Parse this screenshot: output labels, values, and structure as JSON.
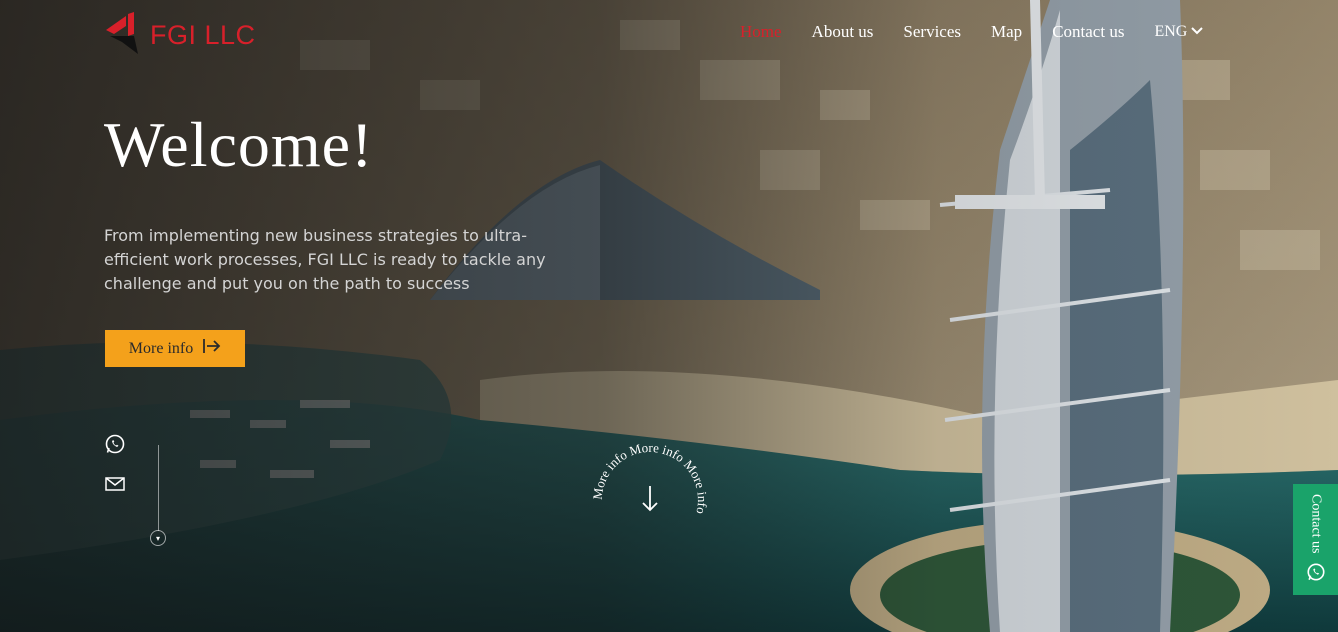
{
  "brand": {
    "name": "FGI LLC",
    "color": "#d8202a"
  },
  "nav": {
    "items": [
      {
        "label": "Home",
        "active": true
      },
      {
        "label": "About us",
        "active": false
      },
      {
        "label": "Services",
        "active": false
      },
      {
        "label": "Map",
        "active": false
      },
      {
        "label": "Contact us",
        "active": false
      }
    ],
    "language": "ENG"
  },
  "hero": {
    "title": "Welcome!",
    "subtitle": "From implementing new business strategies to ultra-efficient work processes, FGI LLC is ready to tackle any challenge and put you on the path to success",
    "cta_label": "More info",
    "cta_color": "#f4a11b"
  },
  "social": {
    "icons": [
      "whatsapp-icon",
      "mail-icon"
    ]
  },
  "circle_badge": {
    "text": "More info More info More info"
  },
  "contact_tab": {
    "label": "Contact us",
    "color": "#1aa36a",
    "icon": "whatsapp-icon"
  }
}
